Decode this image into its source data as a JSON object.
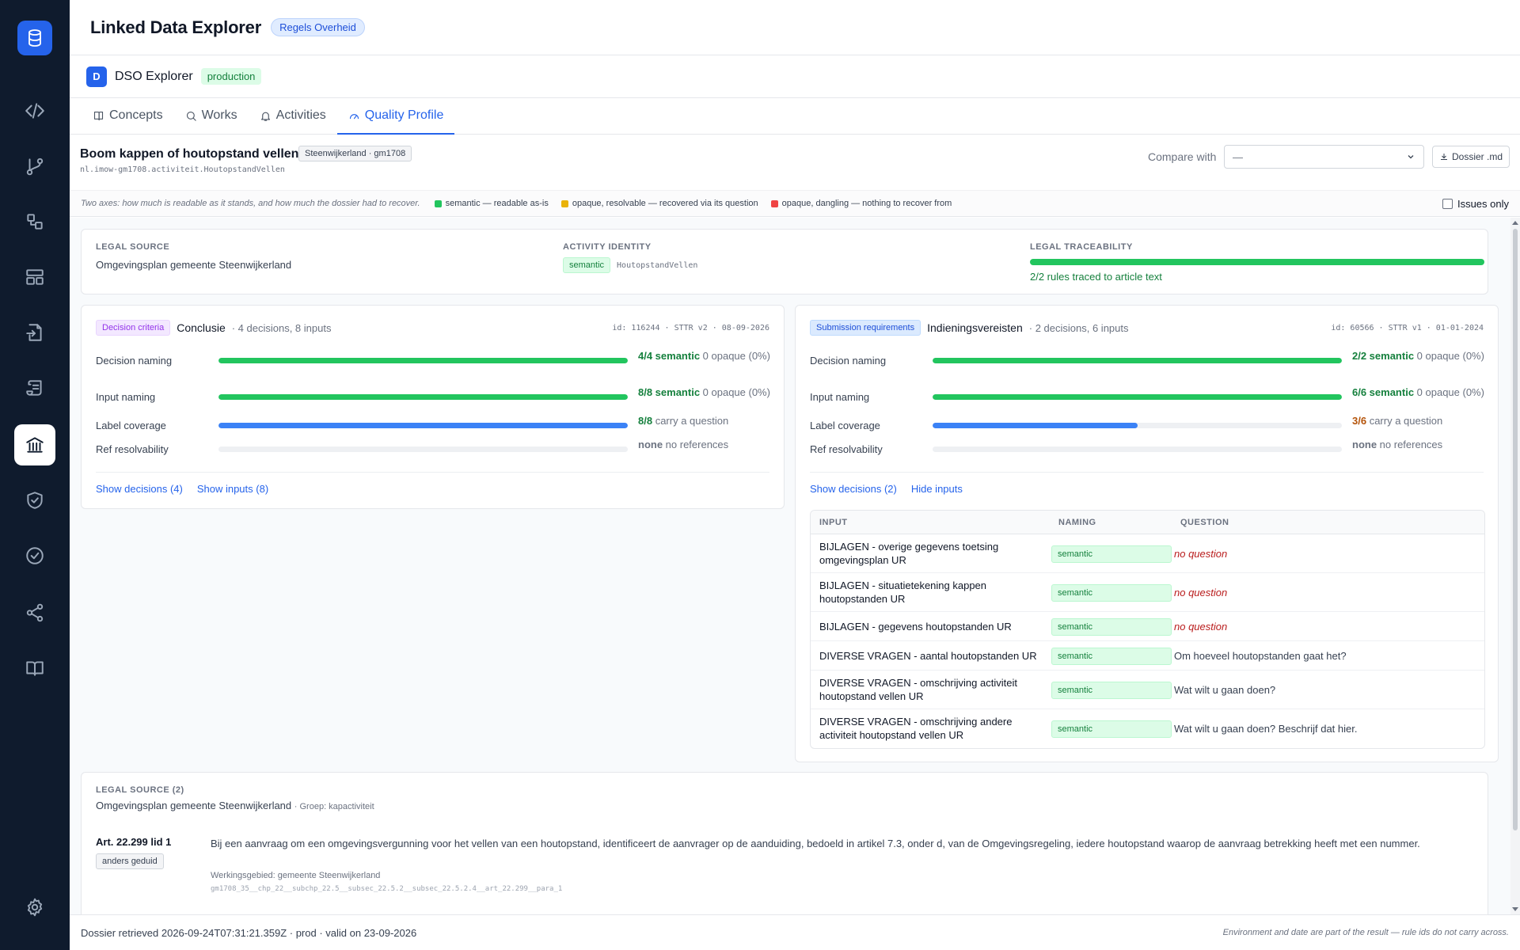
{
  "app": {
    "title": "Linked Data Explorer",
    "org_badge": "Regels Overheid"
  },
  "project": {
    "avatar": "D",
    "name": "DSO Explorer",
    "env": "production"
  },
  "tabs": [
    {
      "label": "Concepts",
      "icon": "book-icon"
    },
    {
      "label": "Works",
      "icon": "search-icon"
    },
    {
      "label": "Activities",
      "icon": "bell-icon"
    },
    {
      "label": "Quality Profile",
      "icon": "gauge-icon",
      "active": true
    }
  ],
  "activity": {
    "title": "Boom kappen of houtopstand vellen",
    "chip": "Steenwijkerland · gm1708",
    "id": "nl.imow-gm1708.activiteit.HoutopstandVellen"
  },
  "compare": {
    "label": "Compare with",
    "value": "—"
  },
  "dossier_button": "Dossier .md",
  "legend": {
    "intro": "Two axes: how much is readable as it stands, and how much the dossier had to recover.",
    "items": [
      {
        "label": "semantic — readable as-is",
        "color": "#22c55e"
      },
      {
        "label": "opaque, resolvable — recovered via its question",
        "color": "#eab308"
      },
      {
        "label": "opaque, dangling — nothing to recover from",
        "color": "#ef4444"
      }
    ],
    "issues_only": "Issues only"
  },
  "summary": {
    "legal_source_label": "LEGAL SOURCE",
    "legal_source_value": "Omgevingsplan gemeente Steenwijkerland",
    "identity_label": "ACTIVITY IDENTITY",
    "identity_badge": "semantic",
    "identity_value": "HoutopstandVellen",
    "traceability_label": "LEGAL TRACEABILITY",
    "traceability_fraction": 1.0,
    "traceability_text": "2/2 rules traced to article text"
  },
  "panels": [
    {
      "badge": "Decision criteria",
      "name": "Conclusie",
      "meta": "· 4 decisions, 8 inputs",
      "id": "id: 116244 · STTR v2 · 08-09-2026",
      "metrics": [
        {
          "label": "Decision naming",
          "fraction": 1.0,
          "value_strong": "4/4 semantic",
          "value_rest": " 0 opaque (0%)",
          "color": "#22c55e",
          "strong_color": "#15803d"
        },
        {
          "label": "Input naming",
          "fraction": 1.0,
          "value_strong": "8/8 semantic",
          "value_rest": " 0 opaque (0%)",
          "color": "#22c55e",
          "strong_color": "#15803d"
        },
        {
          "label": "Label coverage",
          "fraction": 1.0,
          "value_strong": "8/8",
          "value_rest": " carry a question",
          "color": "#3b82f6",
          "strong_color": "#15803d"
        },
        {
          "label": "Ref resolvability",
          "fraction": 0,
          "value_strong": "none",
          "value_rest": " no references",
          "color": "#e5e7eb",
          "strong_color": "#6b7280"
        }
      ],
      "links": [
        "Show decisions (4)",
        "Show inputs (8)"
      ]
    },
    {
      "badge": "Submission requirements",
      "name": "Indieningsvereisten",
      "meta": "· 2 decisions, 6 inputs",
      "id": "id: 60566 · STTR v1 · 01-01-2024",
      "metrics": [
        {
          "label": "Decision naming",
          "fraction": 1.0,
          "value_strong": "2/2 semantic",
          "value_rest": " 0 opaque (0%)",
          "color": "#22c55e",
          "strong_color": "#15803d"
        },
        {
          "label": "Input naming",
          "fraction": 1.0,
          "value_strong": "6/6 semantic",
          "value_rest": " 0 opaque (0%)",
          "color": "#22c55e",
          "strong_color": "#15803d"
        },
        {
          "label": "Label coverage",
          "fraction": 0.5,
          "value_strong": "3/6",
          "value_rest": " carry a question",
          "color": "#3b82f6",
          "strong_color": "#b45309"
        },
        {
          "label": "Ref resolvability",
          "fraction": 0,
          "value_strong": "none",
          "value_rest": " no references",
          "color": "#e5e7eb",
          "strong_color": "#6b7280"
        }
      ],
      "links": [
        "Show decisions (2)",
        "Hide inputs"
      ],
      "inputs_table": {
        "headers": [
          "INPUT",
          "NAMING",
          "QUESTION"
        ],
        "rows": [
          {
            "input": "BIJLAGEN - overige gegevens toetsing omgevingsplan UR",
            "naming": "semantic",
            "question": "no question",
            "missing": true
          },
          {
            "input": "BIJLAGEN - situatietekening kappen houtopstanden UR",
            "naming": "semantic",
            "question": "no question",
            "missing": true
          },
          {
            "input": "BIJLAGEN - gegevens houtopstanden UR",
            "naming": "semantic",
            "question": "no question",
            "missing": true
          },
          {
            "input": "DIVERSE VRAGEN - aantal houtopstanden UR",
            "naming": "semantic",
            "question": "Om hoeveel houtopstanden gaat het?",
            "missing": false
          },
          {
            "input": "DIVERSE VRAGEN - omschrijving activiteit houtopstand vellen UR",
            "naming": "semantic",
            "question": "Wat wilt u gaan doen?",
            "missing": false
          },
          {
            "input": "DIVERSE VRAGEN - omschrijving andere activiteit houtopstand vellen UR",
            "naming": "semantic",
            "question": "Wat wilt u gaan doen? Beschrijf dat hier.",
            "missing": false
          }
        ]
      }
    }
  ],
  "legal_source_2": {
    "label": "LEGAL SOURCE (2)",
    "title": "Omgevingsplan gemeente Steenwijkerland",
    "group": "· Groep: kapactiviteit",
    "article": "Art. 22.299 lid 1",
    "article_badge": "anders geduid",
    "text": "Bij een aanvraag om een omgevingsvergunning voor het vellen van een houtopstand, identificeert de aanvrager op de aanduiding, bedoeld in artikel 7.3, onder d, van de Omgevingsregeling, iedere houtopstand waarop de aanvraag betrekking heeft met een nummer.",
    "werkingsgebied": "Werkingsgebied: gemeente Steenwijkerland",
    "path": "gm1708_35__chp_22__subchp_22.5__subsec_22.5.2__subsec_22.5.2.4__art_22.299__para_1"
  },
  "footer": {
    "status": "Dossier retrieved 2026-09-24T07:31:21.359Z · prod · valid on 23-09-2026",
    "note": "Environment and date are part of the result — rule ids do not carry across."
  },
  "sidebar": {
    "logo_icon": "database-icon",
    "items": [
      "code-icon",
      "git-branch-icon",
      "shapes-icon",
      "layout-icon",
      "file-import-icon",
      "scroll-icon",
      "landmark-icon",
      "shield-check-icon",
      "check-circle-icon",
      "share-icon",
      "book-open-icon"
    ],
    "active": "landmark-icon",
    "bottom": "settings-icon"
  }
}
